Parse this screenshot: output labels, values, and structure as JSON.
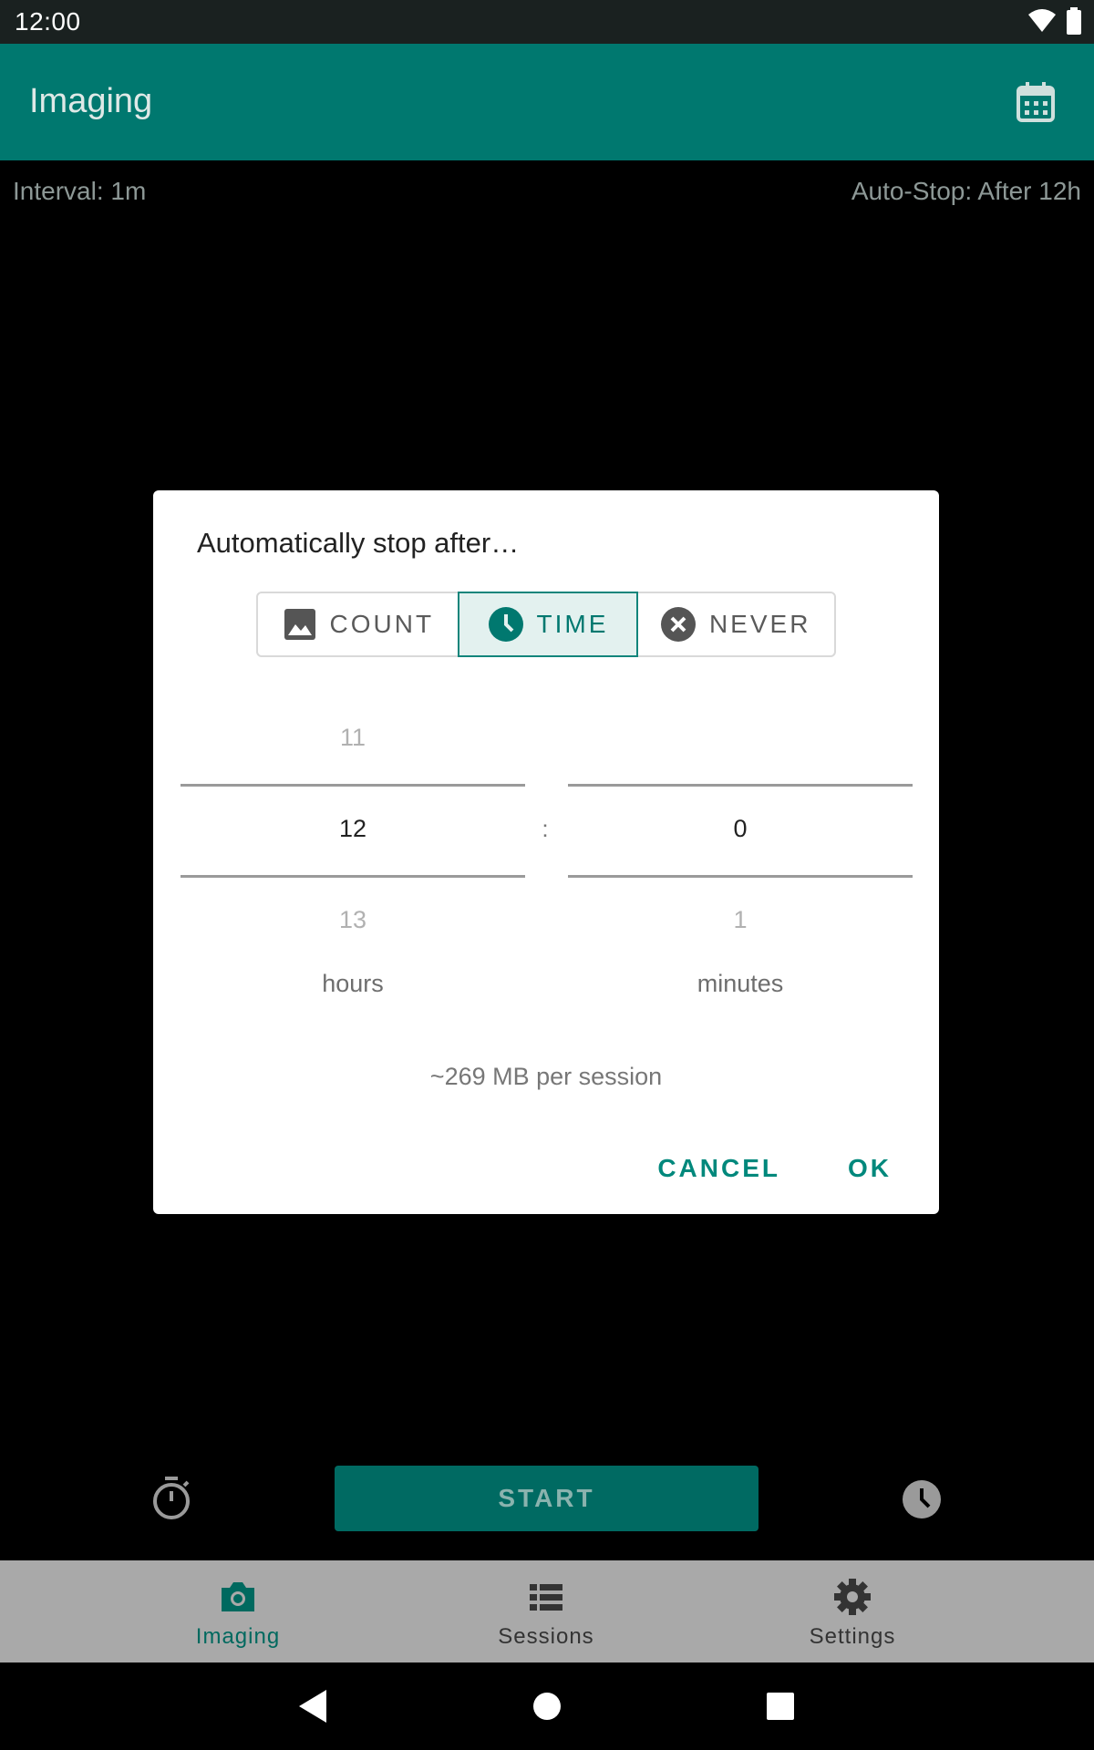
{
  "status_bar": {
    "time": "12:00",
    "icons": [
      "wifi-icon",
      "battery-icon"
    ]
  },
  "app_bar": {
    "title": "Imaging",
    "action_icon": "calendar-icon"
  },
  "info": {
    "interval": "Interval: 1m",
    "auto_stop": "Auto-Stop: After 12h"
  },
  "dialog": {
    "title": "Automatically stop after…",
    "modes": [
      {
        "label": "COUNT",
        "icon": "image-icon",
        "selected": false
      },
      {
        "label": "TIME",
        "icon": "clock-icon",
        "selected": true
      },
      {
        "label": "NEVER",
        "icon": "cancel-circle-icon",
        "selected": false
      }
    ],
    "hours": {
      "prev": "11",
      "current": "12",
      "next": "13",
      "label": "hours"
    },
    "separator": ":",
    "minutes": {
      "prev": "",
      "current": "0",
      "next": "1",
      "label": "minutes"
    },
    "size_estimate": "~269 MB per session",
    "cancel_label": "CANCEL",
    "ok_label": "OK"
  },
  "controls": {
    "start_label": "START",
    "left_icon": "stopwatch-icon",
    "right_icon": "clock-icon"
  },
  "bottom_nav": {
    "items": [
      {
        "label": "Imaging",
        "icon": "camera-icon",
        "active": true
      },
      {
        "label": "Sessions",
        "icon": "list-icon",
        "active": false
      },
      {
        "label": "Settings",
        "icon": "gear-icon",
        "active": false
      }
    ]
  },
  "system_nav": [
    "back-icon",
    "home-icon",
    "recents-icon"
  ],
  "colors": {
    "primary": "#00786f",
    "accent": "#00887c",
    "start_button": "#006a62",
    "toggle_selected_bg": "#e3f1ef"
  }
}
